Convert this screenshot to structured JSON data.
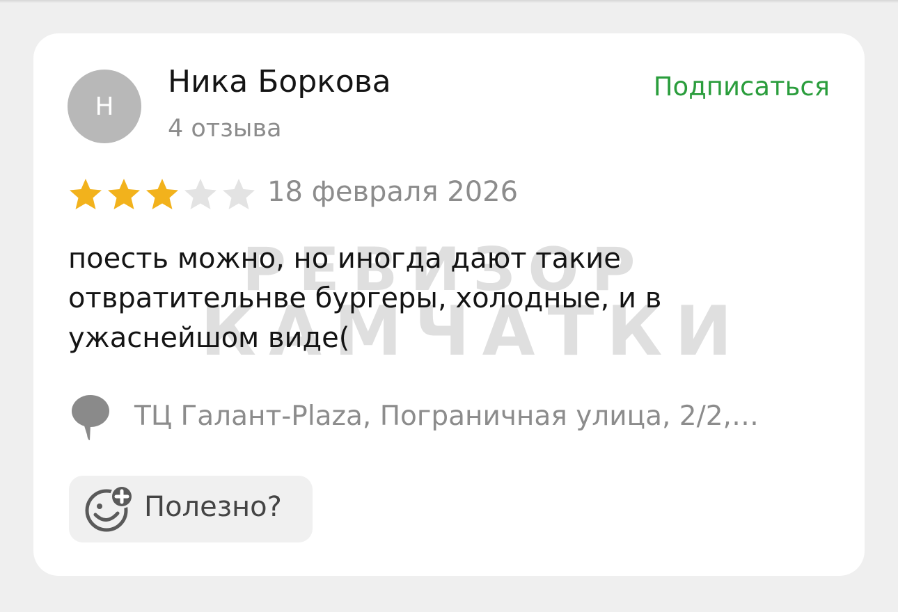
{
  "review": {
    "avatar_letter": "Н",
    "author_name": "Ника Боркова",
    "reviews_count": "4 отзыва",
    "subscribe_label": "Подписаться",
    "rating": 3,
    "rating_max": 5,
    "date": "18 февраля 2026",
    "text": "поесть можно, но иногда дают такие отвратительнве бургеры, холодные, и в ужаснейшом виде(",
    "address": "ТЦ Галант-Plaza, Пограничная улица, 2/2,…",
    "useful_label": "Полезно?"
  },
  "watermark": {
    "line1": "РЕВИЗОР",
    "line2": "КАМЧАТКИ"
  },
  "colors": {
    "accent_green": "#2a9d3c",
    "star_filled": "#f2b21c",
    "star_empty": "#e3e3e3",
    "muted_text": "#8c8c8c",
    "avatar_bg": "#b8b8b8"
  },
  "icons": {
    "location": "map-pin-icon",
    "useful": "smiley-plus-icon"
  }
}
